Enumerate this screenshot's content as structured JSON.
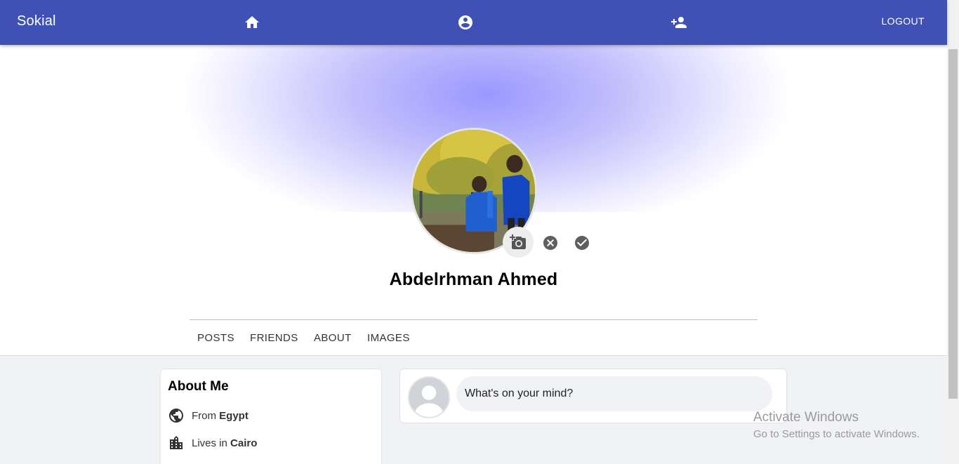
{
  "header": {
    "brand": "Sokial",
    "nav": [
      {
        "name": "home",
        "icon": "home-icon"
      },
      {
        "name": "profile",
        "icon": "account-circle-icon"
      },
      {
        "name": "add-friend",
        "icon": "person-add-icon"
      }
    ],
    "logout_label": "LOGOUT"
  },
  "profile": {
    "name": "Abdelrhman Ahmed",
    "actions": {
      "upload_photo": "add-a-photo-icon",
      "cancel": "cancel-icon",
      "confirm": "check-circle-icon"
    }
  },
  "tabs": [
    "POSTS",
    "FRIENDS",
    "ABOUT",
    "IMAGES"
  ],
  "about": {
    "title": "About Me",
    "from_label": "From",
    "from_value": "Egypt",
    "lives_label": "Lives in",
    "lives_value": "Cairo"
  },
  "composer": {
    "placeholder": "What's on your mind?"
  },
  "watermark": {
    "title": "Activate Windows",
    "subtitle": "Go to Settings to activate Windows."
  },
  "colors": {
    "appbar": "#3f51b5",
    "cover_center": "#9a98ff",
    "page_bg": "#f0f2f5"
  }
}
